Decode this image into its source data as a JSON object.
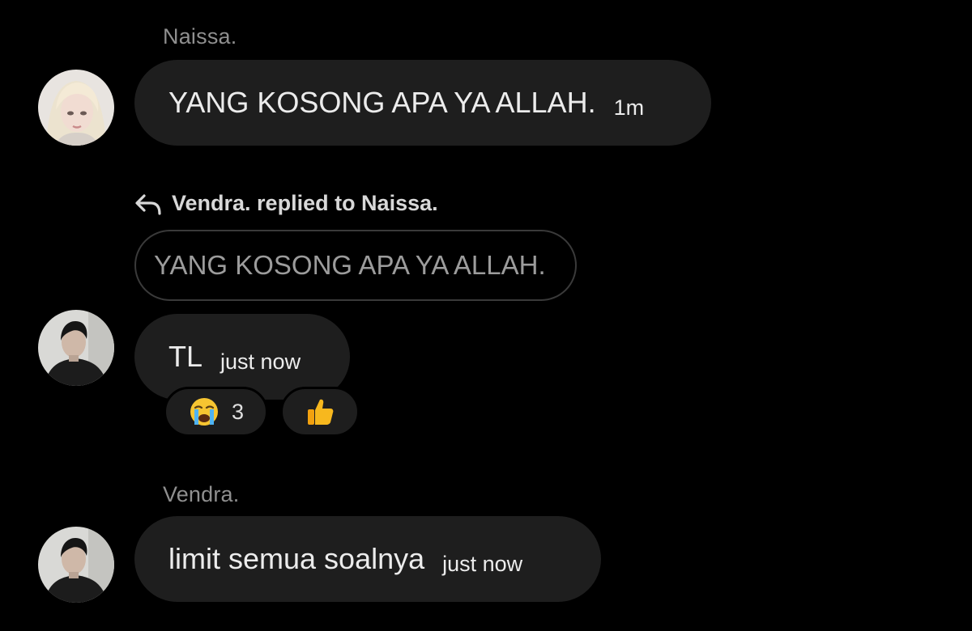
{
  "messages": [
    {
      "sender": "Naissa.",
      "avatar": "naissa-avatar",
      "text": "YANG KOSONG APA YA ALLAH.",
      "time": "1m"
    },
    {
      "reply_context": "Vendra. replied to Naissa.",
      "quoted_text": "YANG KOSONG APA YA ALLAH.",
      "avatar": "vendra-avatar",
      "text": "TL",
      "time": "just now",
      "reactions": [
        {
          "icon": "crying-face-icon",
          "count": "3"
        },
        {
          "icon": "thumbs-up-icon",
          "count": ""
        }
      ]
    },
    {
      "sender": "Vendra.",
      "avatar": "vendra-avatar",
      "text": "limit semua soalnya",
      "time": "just now"
    }
  ],
  "colors": {
    "background": "#000000",
    "bubble": "#1e1e1e",
    "sender_name": "#8f8f8f",
    "quoted_border": "#3a3a3a"
  }
}
